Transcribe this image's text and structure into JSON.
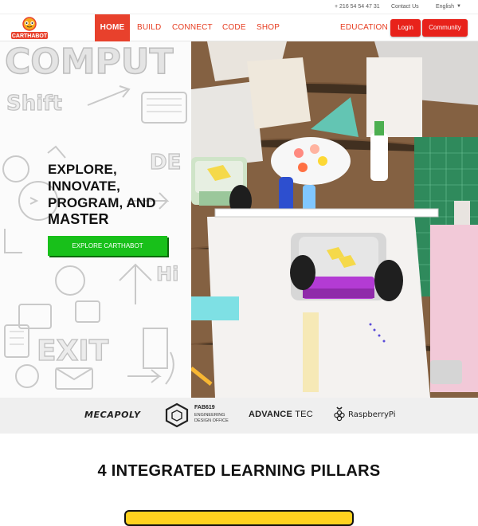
{
  "topbar": {
    "phone": "+ 216 54 54 47 31",
    "contact": "Contact Us",
    "language": "English"
  },
  "brand": {
    "logo_text": "CARTHABOT"
  },
  "nav": {
    "items": [
      {
        "label": "HOME",
        "active": true
      },
      {
        "label": "BUILD"
      },
      {
        "label": "CONNECT"
      },
      {
        "label": "CODE"
      },
      {
        "label": "SHOP"
      },
      {
        "label": "EDUCATION"
      }
    ],
    "login": "Login",
    "community": "Community"
  },
  "hero": {
    "line1": "EXPLORE,",
    "line2": "INNOVATE,",
    "line3": "PROGRAM, AND",
    "line4": "MASTER",
    "cta": "EXPLORE CARTHABOT",
    "doodle_words": [
      "COMPUT",
      "Shift",
      "DE",
      "Hi",
      "EXIT"
    ]
  },
  "partners": {
    "mecapoly": "MECAPOLY",
    "fab_title": "FAB619",
    "fab_sub1": "ENGINEERING",
    "fab_sub2": "DESIGN OFFICE",
    "advance": "ADVANCE",
    "advance_tec": "TEC",
    "raspberry": "RaspberryPi"
  },
  "pillars": {
    "title": "4 INTEGRATED LEARNING PILLARS"
  },
  "colors": {
    "brand_red": "#e8412c",
    "button_red": "#e8221b",
    "cta_green": "#18c01a",
    "pillar_yellow": "#ffd21f"
  }
}
